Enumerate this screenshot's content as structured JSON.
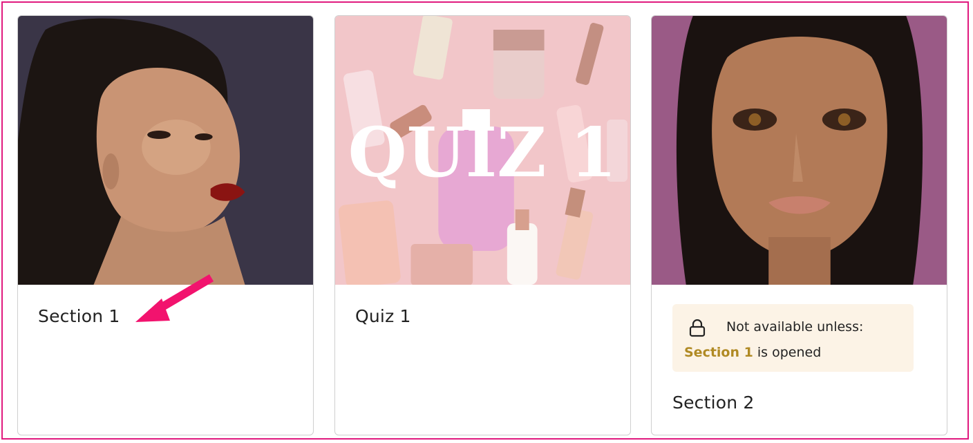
{
  "cards": [
    {
      "title": "Section 1",
      "image": "portrait of woman with red lipstick"
    },
    {
      "title": "Quiz 1",
      "image_overlay_text": "QUIZ 1"
    },
    {
      "title": "Section 2",
      "image": "portrait of woman with bronze makeup",
      "restriction": {
        "icon": "lock-icon",
        "title": "Not available unless:",
        "link_text": "Section 1",
        "suffix": " is opened"
      }
    }
  ],
  "annotation": {
    "icon": "arrow-icon",
    "color": "#f2136e"
  },
  "colors": {
    "frame": "#e0197e",
    "restriction_bg": "#fcf3e6",
    "restriction_link": "#b08a24"
  }
}
